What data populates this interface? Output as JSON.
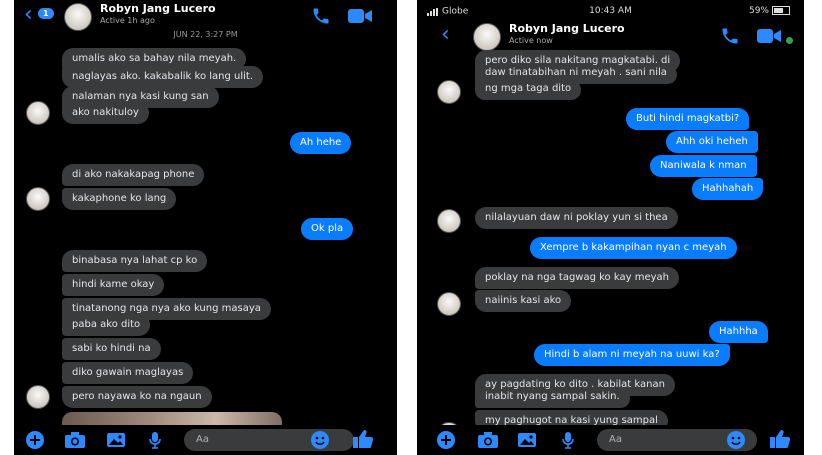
{
  "left": {
    "header": {
      "name": "Robyn Jang Lucero",
      "status": "Active 1h ago",
      "badge": "1"
    },
    "date_separator": "JUN 22, 3:27 PM",
    "messages": [
      {
        "dir": "in",
        "text": "umalis ako sa bahay nila meyah."
      },
      {
        "dir": "in",
        "text": "naglayas ako. kakabalik ko lang ulit."
      },
      {
        "dir": "in",
        "text": "nalaman nya kasi kung san"
      },
      {
        "dir": "in",
        "text": "ako nakituloy"
      },
      {
        "dir": "out",
        "text": "Ah hehe"
      },
      {
        "dir": "in",
        "text": "di ako nakakapag phone"
      },
      {
        "dir": "in",
        "text": "kakaphone ko lang"
      },
      {
        "dir": "out",
        "text": "Ok pla"
      },
      {
        "dir": "in",
        "text": "binabasa nya lahat cp ko"
      },
      {
        "dir": "in",
        "text": "hindi kame okay"
      },
      {
        "dir": "in",
        "text": "tinatanong nga nya ako kung masaya"
      },
      {
        "dir": "in",
        "text": "paba ako dito"
      },
      {
        "dir": "in",
        "text": "sabi ko hindi na"
      },
      {
        "dir": "in",
        "text": "diko gawain maglayas"
      },
      {
        "dir": "in",
        "text": "pero nayawa ko na ngaun"
      }
    ],
    "composer": {
      "placeholder": "Aa"
    }
  },
  "right": {
    "statusbar": {
      "carrier": "Globe",
      "time": "10:43 AM",
      "battery": "59%"
    },
    "header": {
      "name": "Robyn Jang Lucero",
      "status": "Active now"
    },
    "messages": [
      {
        "dir": "in",
        "text": "pero diko sila nakitang magkatabi. di"
      },
      {
        "dir": "in",
        "text": "daw tinatabihan ni meyah . sani nila"
      },
      {
        "dir": "in",
        "text": "ng mga taga dito"
      },
      {
        "dir": "out",
        "text": "Buti hindi magkatbi?"
      },
      {
        "dir": "out",
        "text": "Ahh oki heheh"
      },
      {
        "dir": "out",
        "text": "Naniwala k nman"
      },
      {
        "dir": "out",
        "text": "Hahhahah"
      },
      {
        "dir": "in",
        "text": "nilalayuan daw ni poklay yun si thea"
      },
      {
        "dir": "out",
        "text": "Xempre b kakampihan nyan c meyah"
      },
      {
        "dir": "in",
        "text": "poklay na nga tagwag ko kay meyah"
      },
      {
        "dir": "in",
        "text": "naiinis kasi ako"
      },
      {
        "dir": "out",
        "text": "Hahhha"
      },
      {
        "dir": "out",
        "text": "Hindi b alam ni meyah na uuwi ka?"
      },
      {
        "dir": "in",
        "text": "ay pagdating ko dito . kabilat kanan"
      },
      {
        "dir": "in",
        "text": "inabit nyang sampal sakin."
      },
      {
        "dir": "in",
        "text": "my paghugot na kasi yung sampal"
      }
    ],
    "composer": {
      "placeholder": "Aa"
    }
  },
  "colors": {
    "accent": "#0a7cff",
    "incoming": "#3a3b3c",
    "background": "#000000"
  },
  "icons": [
    "back-arrow-icon",
    "phone-icon",
    "video-camera-icon",
    "plus-icon",
    "camera-icon",
    "gallery-icon",
    "microphone-icon",
    "emoji-icon",
    "thumbs-up-icon"
  ]
}
